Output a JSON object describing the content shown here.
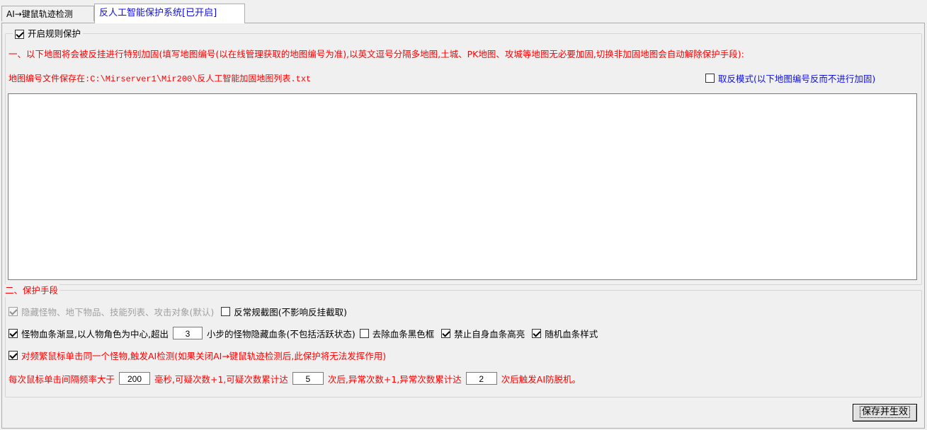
{
  "tabs": [
    {
      "label": "AI→键鼠轨迹检测"
    },
    {
      "label": "反人工智能保护系统[已开启]"
    }
  ],
  "rule_group": {
    "enable_label": "开启规则保护",
    "enable_checked": true,
    "description": "一、以下地图将会被反挂进行特别加固(填写地图编号(以在线管理获取的地图编号为准),以英文逗号分隔多地图,土城、PK地图、攻城等地图无必要加固,切换非加固地图会自动解除保护手段):",
    "file_path": "地图编号文件保存在:C:\\Mirserver1\\Mir200\\反人工智能加固地图列表.txt",
    "invert_label": "取反模式(以下地图编号反而不进行加固)",
    "invert_checked": false,
    "map_list_value": ""
  },
  "protect_group": {
    "title": "二、保护手段",
    "hide_label": "隐藏怪物、地下物品、技能列表、攻击对象(默认)",
    "hide_checked": true,
    "anti_screenshot_label": "反常规截图(不影响反挂截取)",
    "anti_screenshot_checked": false,
    "fade_label_before": "怪物血条渐显,以人物角色为中心,超出",
    "fade_steps": "3",
    "fade_label_after": "小步的怪物隐藏血条(不包括活跃状态)",
    "fade_checked": true,
    "remove_frame_label": "去除血条黑色框",
    "remove_frame_checked": false,
    "disable_highlight_label": "禁止自身血条高亮",
    "disable_highlight_checked": true,
    "random_style_label": "随机血条样式",
    "random_style_checked": true,
    "frequent_click_label": "对频繁鼠标单击同一个怪物,触发AI检测(如果关闭AI→键鼠轨迹检测后,此保护将无法发挥作用)",
    "frequent_click_checked": true,
    "interval_prefix": "每次鼠标单击间隔频率大于",
    "interval_ms": "200",
    "interval_mid1": "毫秒,可疑次数+1,可疑次数累计达",
    "suspicious_count": "5",
    "interval_mid2": "次后,异常次数+1,异常次数累计达",
    "abnormal_count": "2",
    "interval_suffix": "次后触发AI防脱机。"
  },
  "save_button": "保存并生效"
}
